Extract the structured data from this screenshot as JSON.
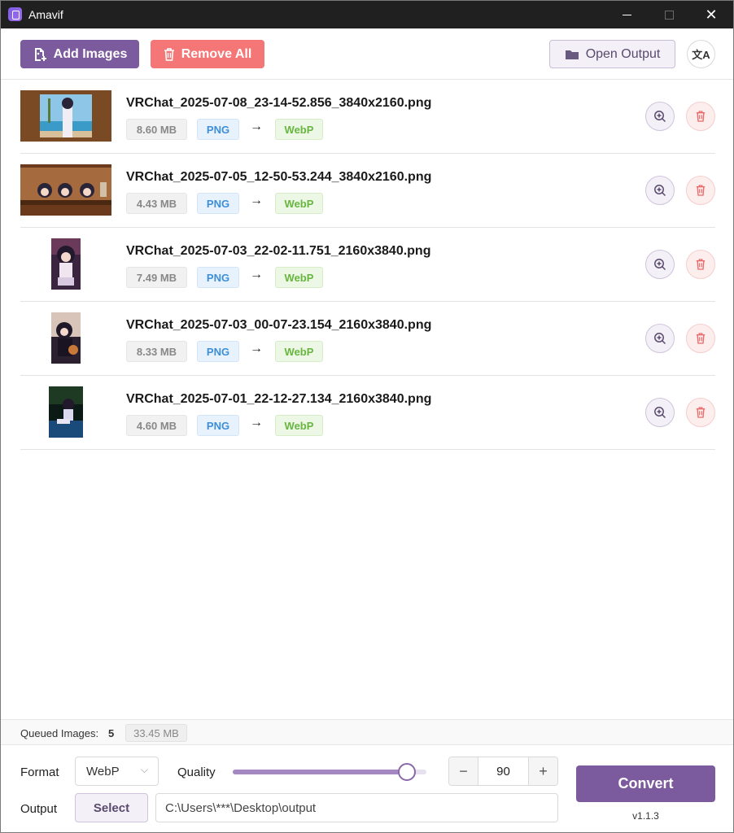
{
  "window": {
    "title": "Amavif",
    "close_glyph": "✕"
  },
  "toolbar": {
    "add_images_label": "Add Images",
    "remove_all_label": "Remove All",
    "open_output_label": "Open Output",
    "translate_glyph": "文A"
  },
  "files": [
    {
      "name": "VRChat_2025-07-08_23-14-52.856_3840x2160.png",
      "size": "8.60 MB",
      "from": "PNG",
      "to": "WebP",
      "orientation": "landscape"
    },
    {
      "name": "VRChat_2025-07-05_12-50-53.244_3840x2160.png",
      "size": "4.43 MB",
      "from": "PNG",
      "to": "WebP",
      "orientation": "landscape"
    },
    {
      "name": "VRChat_2025-07-03_22-02-11.751_2160x3840.png",
      "size": "7.49 MB",
      "from": "PNG",
      "to": "WebP",
      "orientation": "portrait"
    },
    {
      "name": "VRChat_2025-07-03_00-07-23.154_2160x3840.png",
      "size": "8.33 MB",
      "from": "PNG",
      "to": "WebP",
      "orientation": "portrait"
    },
    {
      "name": "VRChat_2025-07-01_22-12-27.134_2160x3840.png",
      "size": "4.60 MB",
      "from": "PNG",
      "to": "WebP",
      "orientation": "portrait"
    }
  ],
  "arrow_glyph": "→",
  "status": {
    "queued_label": "Queued Images:",
    "queued_count": "5",
    "total_size": "33.45 MB"
  },
  "settings": {
    "format_label": "Format",
    "format_value": "WebP",
    "quality_label": "Quality",
    "quality_value": "90",
    "quality_fraction": 0.9,
    "minus_glyph": "−",
    "plus_glyph": "+",
    "output_label": "Output",
    "select_label": "Select",
    "output_path": "C:\\Users\\***\\Desktop\\output",
    "convert_label": "Convert",
    "version": "v1.1.3"
  },
  "colors": {
    "accent": "#7c5a9e",
    "danger": "#f47676",
    "png_tag": "#3d8ed8",
    "webp_tag": "#67b63f"
  }
}
